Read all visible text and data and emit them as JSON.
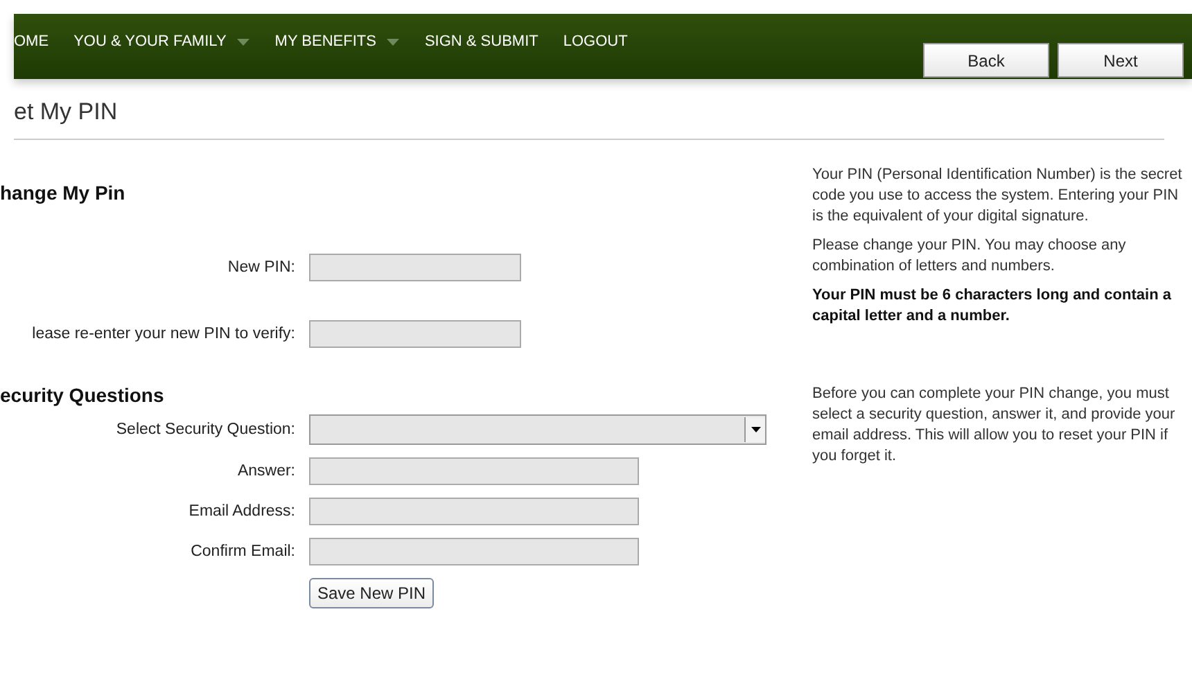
{
  "nav": {
    "items": [
      {
        "label": "OME",
        "has_menu": false
      },
      {
        "label": "YOU & YOUR FAMILY",
        "has_menu": true
      },
      {
        "label": "MY BENEFITS",
        "has_menu": true
      },
      {
        "label": "SIGN & SUBMIT",
        "has_menu": false
      },
      {
        "label": "LOGOUT",
        "has_menu": false
      }
    ],
    "buttons": [
      "Back",
      "Next"
    ]
  },
  "page_title": "et My PIN",
  "sections": [
    {
      "heading": "hange My Pin",
      "fields": [
        {
          "label": "New PIN:",
          "kind": "short"
        },
        {
          "label": "lease re-enter your new PIN to verify:",
          "kind": "short"
        }
      ],
      "help": [
        {
          "text": "Your PIN (Personal Identification Number) is the secret code you use to access the system. Entering your PIN is the equivalent of your digital signature.",
          "bold": false
        },
        {
          "text": "Please change your PIN. You may choose any combination of letters and numbers.",
          "bold": false
        },
        {
          "text": "Your PIN must be 6 characters long and contain a capital letter and a number.",
          "bold": true
        }
      ]
    },
    {
      "heading": "ecurity Questions",
      "fields": [
        {
          "label": "Select Security Question:",
          "kind": "select"
        },
        {
          "label": "Answer:",
          "kind": "long"
        },
        {
          "label": "Email Address:",
          "kind": "long"
        },
        {
          "label": "Confirm Email:",
          "kind": "long"
        }
      ],
      "help": [
        {
          "text": "Before you can complete your PIN change, you must select a security question, answer it, and provide your email address. This will allow you to reset your PIN if you forget it.",
          "bold": false
        }
      ],
      "button": "Save New PIN"
    }
  ]
}
